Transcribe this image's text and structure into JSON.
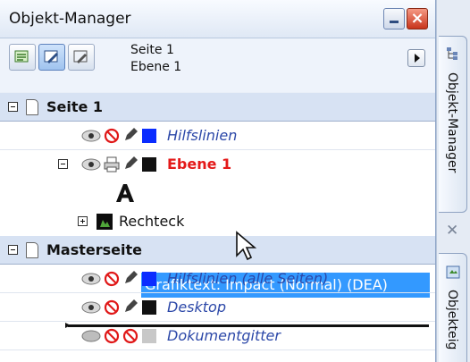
{
  "panel": {
    "title": "Objekt-Manager"
  },
  "toolbar": {
    "page_line": "Seite 1",
    "layer_line": "Ebene 1"
  },
  "tree": {
    "page1": {
      "label": "Seite 1"
    },
    "hilfslinien": {
      "label": "Hilfslinien",
      "color": "#0a2cff"
    },
    "ebene1": {
      "label": "Ebene 1",
      "color": "#111111"
    },
    "grafiktext": {
      "label": "Grafiktext: Impact (Normal) (DEA)"
    },
    "rechteck": {
      "label": "Rechteck"
    },
    "masterseite": {
      "label": "Masterseite"
    },
    "hilfslinien_all": {
      "label": "Hilfslinien (alle Seiten)",
      "color": "#0a2cff"
    },
    "desktop": {
      "label": "Desktop",
      "color": "#111111"
    },
    "dokumentgitter": {
      "label": "Dokumentgitter",
      "color": "#c8c8c8"
    }
  },
  "sidebar": {
    "tab1": "Objekt-Manager",
    "tab2": "Objekteig"
  }
}
